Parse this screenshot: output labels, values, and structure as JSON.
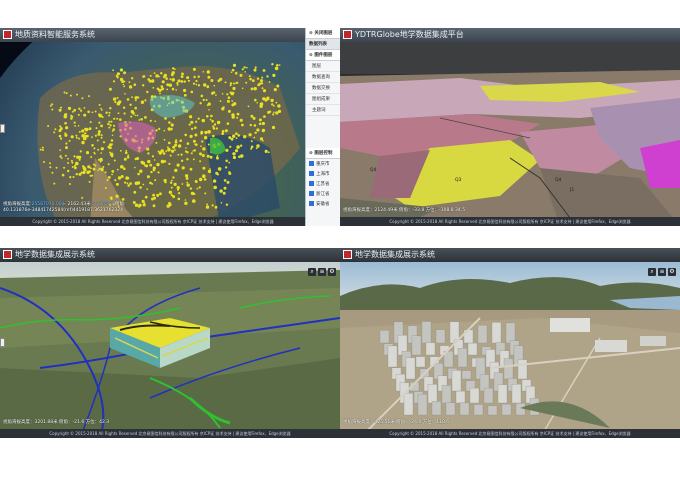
{
  "panels": {
    "top_left": {
      "title": "地质资料智能服务系统",
      "coords_line1_prefix": "视角海拔高度:",
      "coords_line1_link": "25587070.00米",
      "coords_line1_mid": "  2162.43米  ",
      "coords_line1_link2": "5.236554",
      "coords_line1_suffix": "  俯角:",
      "coords_line2": "40.131876e-34841742584(ref)4419187.3621762324",
      "footer": "Copyright © 2015-2018 All Rights Reserved 北京易图信科技有限公司版权所有 京ICP证 技术支持 | 建议使用Firefox、Edge浏览器",
      "sidebar": {
        "top_button": "关闭图层",
        "section1": "数据列表",
        "section2": "图件图册",
        "items": [
          "图层",
          "数据查询",
          "数据交换",
          "图组成果",
          "主题词"
        ],
        "section3": "图层控制",
        "checks": [
          "重庆市",
          "上海市",
          "江苏省",
          "浙江省",
          "安徽省"
        ]
      }
    },
    "top_right": {
      "title": "YDTRGlobe地学数据集成平台",
      "coords": "视角海拔高度：2124.49米  俯角：-33.8  方位：-108.8  34.5",
      "footer": "Copyright © 2015-2018 All Rights Reserved 北京易图信科技有限公司版权所有 京ICP证 技术支持 | 建议使用Firefox、Edge浏览器",
      "labels": [
        "Q4",
        "Q3",
        "J1",
        "Qd"
      ]
    },
    "bottom_left": {
      "title": "地学数据集成展示系统",
      "coords": "视角海拔高度：3201.88米  俯角：-21.6  方位：42.3",
      "footer": "Copyright © 2015-2018 All Rights Reserved 北京易图信科技有限公司版权所有 京ICP证 技术支持 | 建议使用Firefox、Edge浏览器"
    },
    "bottom_right": {
      "title": "地学数据集成展示系统",
      "coords": "视角海拔高度：425.51米  俯角：-24.0  方位：118.6",
      "footer": "Copyright © 2015-2018 All Rights Reserved 北京易图信科技有限公司版权所有 京ICP证 技术支持 | 建议使用Firefox、Edge浏览器"
    }
  },
  "toolbar_icons": [
    "search-icon",
    "layers-icon",
    "settings-icon"
  ],
  "colors": {
    "titlebar": "#4a525c",
    "geology_yellow": "#e8e020",
    "pipeline_blue": "#2438c8",
    "vegetation_green": "#38c838",
    "checkbox_blue": "#2d6fd6"
  }
}
